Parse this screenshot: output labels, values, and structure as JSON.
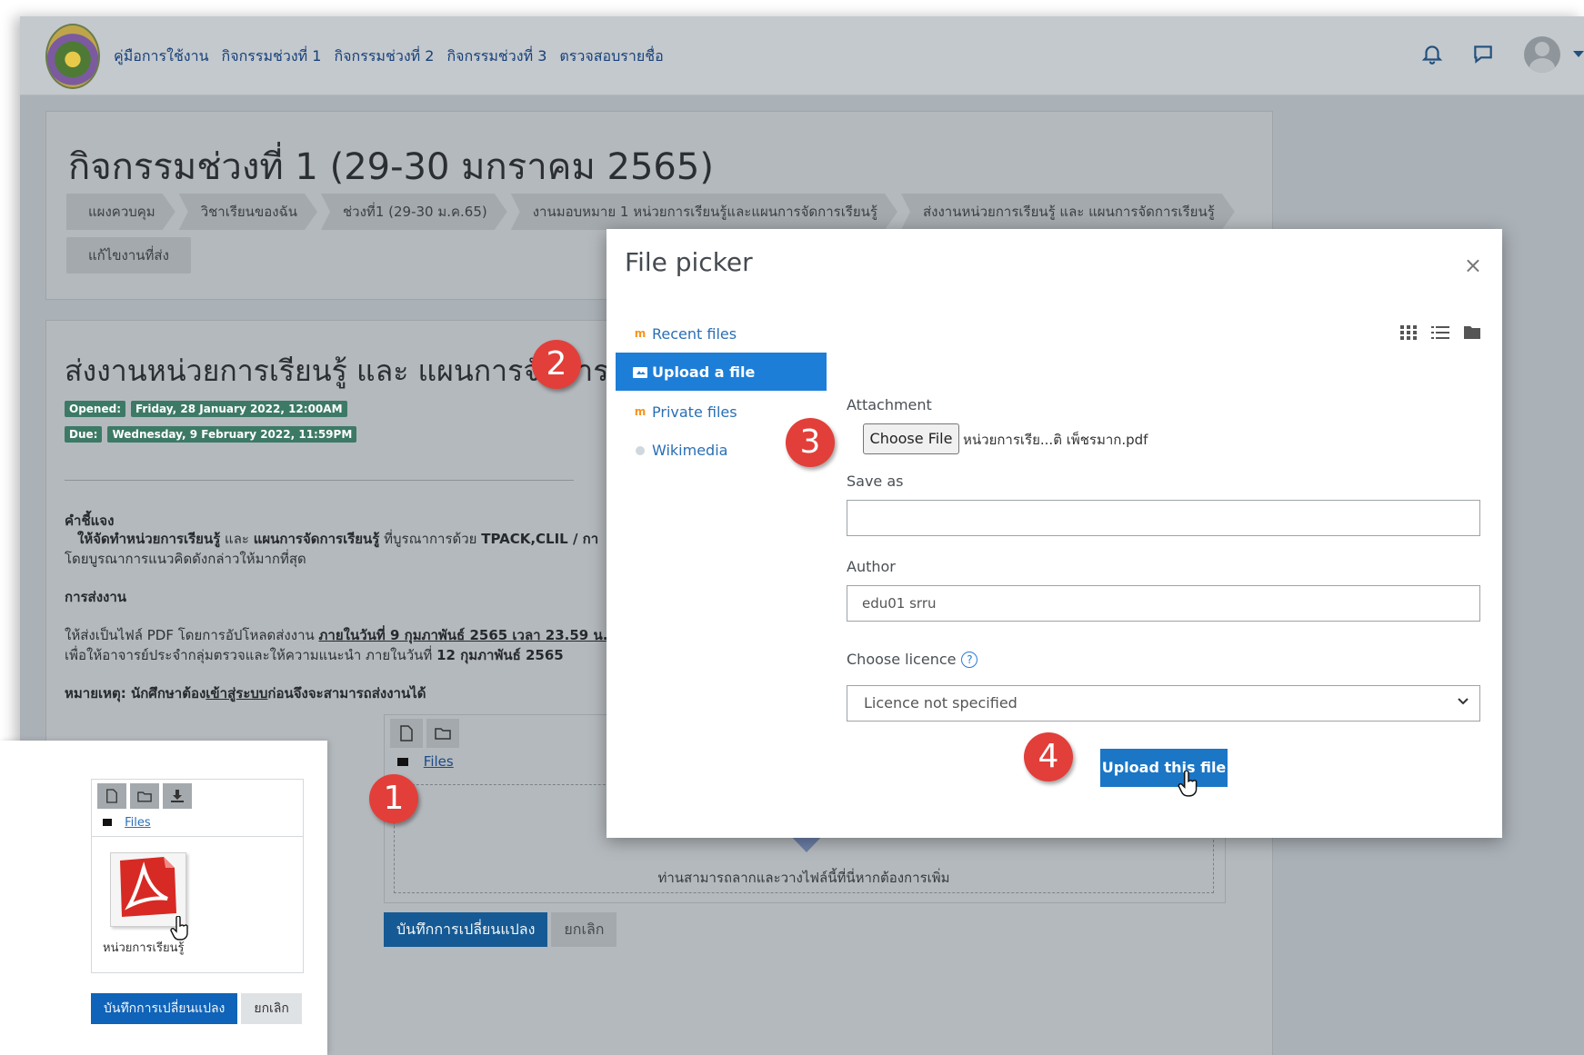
{
  "nav": {
    "links": [
      "คู่มือการใช้งาน",
      "กิจกรรมช่วงที่ 1",
      "กิจกรรมช่วงที่ 2",
      "กิจกรรมช่วงที่ 3",
      "ตรวจสอบรายชื่อ"
    ]
  },
  "page": {
    "title": "กิจกรรมช่วงที่ 1 (29-30 มกราคม 2565)",
    "breadcrumbs": [
      "แผงควบคุม",
      "วิชาเรียนของฉัน",
      "ช่วงที่1 (29-30 ม.ค.65)",
      "งานมอบหมาย 1 หน่วยการเรียนรู้และแผนการจัดการเรียนรู้",
      "ส่งงานหน่วยการเรียนรู้ และ แผนการจัดการเรียนรู้",
      "แก้ไขงานที่ส่ง"
    ]
  },
  "assignment": {
    "title": "ส่งงานหน่วยการเรียนรู้ และ แผนการจัดการเรียนรู้",
    "opened_label": "Opened:",
    "opened_value": "Friday, 28 January 2022, 12:00AM",
    "due_label": "Due:",
    "due_value": "Wednesday, 9 February 2022, 11:59PM",
    "instructions_heading": "คำชี้แจง",
    "instr_b1": "ให้จัดทำหน่วยการเรียนรู้",
    "instr_and": " และ ",
    "instr_b2": "แผนการจัดการเรียนรู้",
    "instr_rest": " ที่บูรณาการด้วย ",
    "instr_b3": "TPACK,CLIL / กา",
    "instr_line2": "โดยบูรณาการแนวคิดดังกล่าวให้มากที่สุด",
    "submit_heading": "การส่งงาน",
    "submit_line1_a": "ให้ส่งเป็นไฟล์ PDF โดยการอัปโหลดส่งงาน ",
    "submit_line1_b": "ภายในวันที่ 9 กุมภาพันธ์ 2565 เวลา 23.59 น.",
    "submit_line2_a": "เพื่อให้อาจารย์ประจำกลุ่มตรวจและให้ความแนะนำ  ภายในวันที่ ",
    "submit_line2_b": "12 กุมภาพันธ์ 2565",
    "note_a": "หมายเหตุ: นักศึกษาต้อง",
    "note_link": "เข้าสู่ระบบ",
    "note_b": "ก่อนจึงจะสามารถส่งงานได้"
  },
  "filemanager": {
    "files_label": "Files",
    "drop_text": "ท่านสามารถลากและวางไฟล์นี้ที่นี่หากต้องการเพิ่ม",
    "save_label": "บันทึกการเปลี่ยนแปลง",
    "cancel_label": "ยกเลิก"
  },
  "inset": {
    "files_label": "Files",
    "file_name": "หน่วยการเรียนรู้",
    "save_label": "บันทึกการเปลี่ยนแปลง",
    "cancel_label": "ยกเลิก"
  },
  "picker": {
    "title": "File picker",
    "close": "×",
    "repos": [
      "Recent files",
      "Upload a file",
      "Private files",
      "Wikimedia"
    ],
    "attachment_label": "Attachment",
    "choose_file_label": "Choose File",
    "chosen_file": "หน่วยการเรีย...ติ เพ็ชรมาก.pdf",
    "save_as_label": "Save as",
    "save_as_value": "",
    "author_label": "Author",
    "author_value": "edu01 srru",
    "licence_label": "Choose licence",
    "licence_value": "Licence not specified",
    "upload_label": "Upload this file"
  },
  "steps": [
    "1",
    "2",
    "3",
    "4"
  ],
  "colors": {
    "accent": "#1b76c6",
    "badge": "#e23f3a",
    "primary_dark": "#155a94"
  }
}
